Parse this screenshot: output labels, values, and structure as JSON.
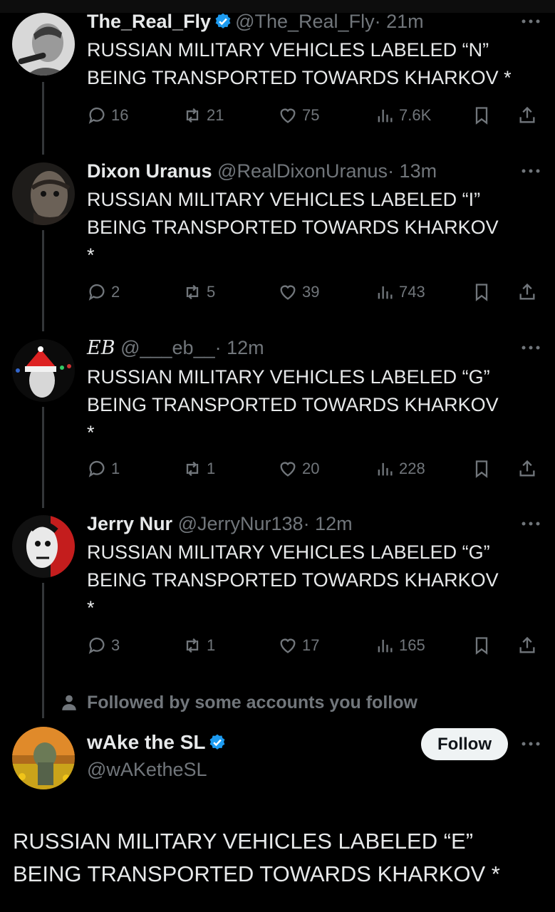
{
  "tweets": [
    {
      "name": "The_Real_Fly",
      "verified": true,
      "handle": "@The_Real_Fly",
      "time": "· 21m",
      "text_line1": "RUSSIAN MILITARY VEHICLES LABELED “N”",
      "text_line2": "BEING TRANSPORTED TOWARDS KHARKOV *",
      "text_line3": "",
      "replies": "16",
      "reposts": "21",
      "likes": "75",
      "views": "7.6K"
    },
    {
      "name": "Dixon Uranus",
      "verified": false,
      "handle": "@RealDixonUranus",
      "time": "· 13m",
      "text_line1": "RUSSIAN MILITARY VEHICLES LABELED “I”",
      "text_line2": "BEING TRANSPORTED TOWARDS KHARKOV",
      "text_line3": "*",
      "replies": "2",
      "reposts": "5",
      "likes": "39",
      "views": "743"
    },
    {
      "name": "EB",
      "verified": false,
      "handle": "@___eb__",
      "time": "· 12m",
      "text_line1": "RUSSIAN MILITARY VEHICLES LABELED “G”",
      "text_line2": "BEING TRANSPORTED TOWARDS KHARKOV",
      "text_line3": "*",
      "replies": "1",
      "reposts": "1",
      "likes": "20",
      "views": "228"
    },
    {
      "name": "Jerry Nur",
      "verified": false,
      "handle": "@JerryNur138",
      "time": "· 12m",
      "text_line1": "RUSSIAN MILITARY VEHICLES LABELED “G”",
      "text_line2": "BEING TRANSPORTED TOWARDS KHARKOV",
      "text_line3": "*",
      "replies": "3",
      "reposts": "1",
      "likes": "17",
      "views": "165"
    }
  ],
  "followed_notice": "Followed by some accounts you follow",
  "main": {
    "name": "wAke the SL",
    "handle": "@wAKetheSL",
    "follow_label": "Follow",
    "text_line1": "RUSSIAN MILITARY VEHICLES LABELED “E”",
    "text_line2": "BEING TRANSPORTED TOWARDS KHARKOV *"
  },
  "icons": {
    "reply": "reply-icon",
    "repost": "repost-icon",
    "like": "like-icon",
    "views": "views-icon",
    "bookmark": "bookmark-icon",
    "share": "share-icon",
    "verified": "verified-badge-icon",
    "more": "more-icon",
    "person": "person-icon"
  },
  "colors": {
    "background": "#000000",
    "text": "#e7e9ea",
    "muted": "#71767b",
    "verified": "#1d9bf0",
    "thread_line": "#333639"
  }
}
